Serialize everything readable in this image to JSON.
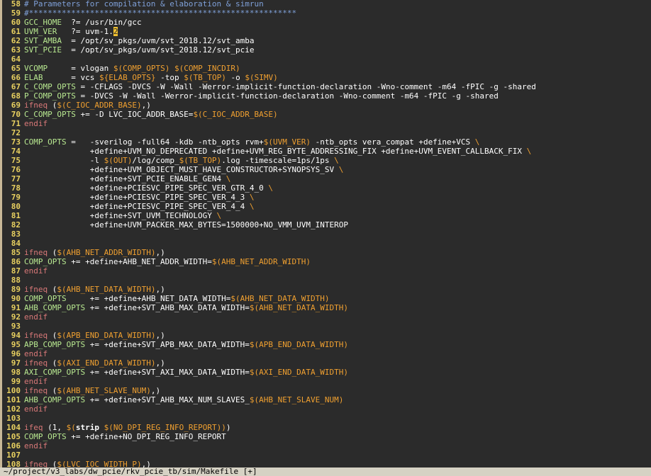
{
  "window": {
    "status_line": "~/project/v3_labs/dw_pcie/rkv_pcie_tb/sim/Makefile [+]"
  },
  "colors": {
    "background": "#2b2b2b",
    "line_number": "#e8d060",
    "comment": "#7fa0d8",
    "variable_ref": "#f0a030",
    "identifier": "#b8e890",
    "keyword": "#d87878",
    "text": "#ffffff",
    "cursor": "#f0c030",
    "status_bg": "#d6d2c4"
  },
  "lines": [
    {
      "n": "58",
      "t": [
        [
          "comment",
          "# Parameters for compilation & elaboration & simrun"
        ]
      ]
    },
    {
      "n": "59",
      "t": [
        [
          "comment",
          "#*********************************************************"
        ]
      ]
    },
    {
      "n": "60",
      "t": [
        [
          "ident",
          "GCC_HOME"
        ],
        [
          "normal",
          "  ?= /usr/bin/gcc"
        ]
      ]
    },
    {
      "n": "61",
      "t": [
        [
          "ident",
          "UVM_VER"
        ],
        [
          "normal",
          "   ?= uvm-1."
        ],
        [
          "cursor",
          "2"
        ]
      ]
    },
    {
      "n": "62",
      "t": [
        [
          "ident",
          "SVT_AMBA"
        ],
        [
          "normal",
          "  = /opt/sv_pkgs/uvm/svt_2018.12/svt_amba"
        ]
      ]
    },
    {
      "n": "63",
      "t": [
        [
          "ident",
          "SVT_PCIE"
        ],
        [
          "normal",
          "  = /opt/sv_pkgs/uvm/svt_2018.12/svt_pcie"
        ]
      ]
    },
    {
      "n": "64",
      "t": []
    },
    {
      "n": "65",
      "t": [
        [
          "ident",
          "VCOMP"
        ],
        [
          "normal",
          "     = vlogan "
        ],
        [
          "var",
          "$(COMP_OPTS)"
        ],
        [
          "normal",
          " "
        ],
        [
          "var",
          "$(COMP_INCDIR)"
        ]
      ]
    },
    {
      "n": "66",
      "t": [
        [
          "ident",
          "ELAB"
        ],
        [
          "normal",
          "      = vcs "
        ],
        [
          "var",
          "${ELAB_OPTS}"
        ],
        [
          "normal",
          " -top "
        ],
        [
          "var",
          "$(TB_TOP)"
        ],
        [
          "normal",
          " -o "
        ],
        [
          "var",
          "$(SIMV)"
        ]
      ]
    },
    {
      "n": "67",
      "t": [
        [
          "ident",
          "C_COMP_OPTS"
        ],
        [
          "normal",
          " = -CFLAGS -DVCS -W -Wall -Werror-implicit-function-declaration -Wno-comment -m64 -fPIC -g -shared"
        ]
      ]
    },
    {
      "n": "68",
      "t": [
        [
          "ident",
          "P_COMP_OPTS"
        ],
        [
          "normal",
          " = -DVCS -W -Wall -Werror-implicit-function-declaration -Wno-comment -m64 -fPIC -g -shared"
        ]
      ]
    },
    {
      "n": "69",
      "t": [
        [
          "keyword",
          "ifneq"
        ],
        [
          "normal",
          " ("
        ],
        [
          "var",
          "$(C_IOC_ADDR_BASE)"
        ],
        [
          "normal",
          ",)"
        ]
      ]
    },
    {
      "n": "70",
      "t": [
        [
          "ident",
          "C_COMP_OPTS"
        ],
        [
          "normal",
          " += -D LVC_IOC_ADDR_BASE="
        ],
        [
          "var",
          "$(C_IOC_ADDR_BASE)"
        ]
      ]
    },
    {
      "n": "71",
      "t": [
        [
          "keyword",
          "endif"
        ]
      ]
    },
    {
      "n": "72",
      "t": []
    },
    {
      "n": "73",
      "t": [
        [
          "ident",
          "COMP_OPTS"
        ],
        [
          "normal",
          " =   -sverilog -full64 -kdb -ntb_opts rvm+"
        ],
        [
          "var",
          "$(UVM_VER)"
        ],
        [
          "normal",
          " -ntb_opts vera_compat +define+VCS "
        ],
        [
          "var",
          "\\"
        ]
      ]
    },
    {
      "n": "74",
      "t": [
        [
          "normal",
          "              +define+UVM_NO_DEPRECATED +define+UVM_REG_BYTE_ADDRESSING_FIX +define+UVM_EVENT_CALLBACK_FIX "
        ],
        [
          "var",
          "\\"
        ]
      ]
    },
    {
      "n": "75",
      "t": [
        [
          "normal",
          "              -l "
        ],
        [
          "var",
          "$(OUT)"
        ],
        [
          "normal",
          "/log/comp_"
        ],
        [
          "var",
          "$(TB_TOP)"
        ],
        [
          "normal",
          ".log -timescale=1ps/1ps "
        ],
        [
          "var",
          "\\"
        ]
      ]
    },
    {
      "n": "76",
      "t": [
        [
          "normal",
          "              +define+UVM_OBJECT_MUST_HAVE_CONSTRUCTOR+SYNOPSYS_SV "
        ],
        [
          "var",
          "\\"
        ]
      ]
    },
    {
      "n": "77",
      "t": [
        [
          "normal",
          "              +define+SVT_PCIE_ENABLE_GEN4 "
        ],
        [
          "var",
          "\\"
        ]
      ]
    },
    {
      "n": "78",
      "t": [
        [
          "normal",
          "              +define+PCIESVC_PIPE_SPEC_VER_GTR_4_0 "
        ],
        [
          "var",
          "\\"
        ]
      ]
    },
    {
      "n": "79",
      "t": [
        [
          "normal",
          "              +define+PCIESVC_PIPE_SPEC_VER_4_3 "
        ],
        [
          "var",
          "\\"
        ]
      ]
    },
    {
      "n": "80",
      "t": [
        [
          "normal",
          "              +define+PCIESVC_PIPE_SPEC_VER_4_4 "
        ],
        [
          "var",
          "\\"
        ]
      ]
    },
    {
      "n": "81",
      "t": [
        [
          "normal",
          "              +define+SVT_UVM_TECHNOLOGY "
        ],
        [
          "var",
          "\\"
        ]
      ]
    },
    {
      "n": "82",
      "t": [
        [
          "normal",
          "              +define+UVM_PACKER_MAX_BYTES=1500000+NO_VMM_UVM_INTEROP"
        ]
      ]
    },
    {
      "n": "83",
      "t": []
    },
    {
      "n": "84",
      "t": []
    },
    {
      "n": "85",
      "t": [
        [
          "keyword",
          "ifneq"
        ],
        [
          "normal",
          " ("
        ],
        [
          "var",
          "$(AHB_NET_ADDR_WIDTH)"
        ],
        [
          "normal",
          ",)"
        ]
      ]
    },
    {
      "n": "86",
      "t": [
        [
          "ident",
          "COMP_OPTS"
        ],
        [
          "normal",
          " += +define+AHB_NET_ADDR_WIDTH="
        ],
        [
          "var",
          "$(AHB_NET_ADDR_WIDTH)"
        ]
      ]
    },
    {
      "n": "87",
      "t": [
        [
          "keyword",
          "endif"
        ]
      ]
    },
    {
      "n": "88",
      "t": []
    },
    {
      "n": "89",
      "t": [
        [
          "keyword",
          "ifneq"
        ],
        [
          "normal",
          " ("
        ],
        [
          "var",
          "$(AHB_NET_DATA_WIDTH)"
        ],
        [
          "normal",
          ",)"
        ]
      ]
    },
    {
      "n": "90",
      "t": [
        [
          "ident",
          "COMP_OPTS"
        ],
        [
          "normal",
          "     += +define+AHB_NET_DATA_WIDTH="
        ],
        [
          "var",
          "$(AHB_NET_DATA_WIDTH)"
        ]
      ]
    },
    {
      "n": "91",
      "t": [
        [
          "ident",
          "AHB_COMP_OPTS"
        ],
        [
          "normal",
          " += +define+SVT_AHB_MAX_DATA_WIDTH="
        ],
        [
          "var",
          "$(AHB_NET_DATA_WIDTH)"
        ]
      ]
    },
    {
      "n": "92",
      "t": [
        [
          "keyword",
          "endif"
        ]
      ]
    },
    {
      "n": "93",
      "t": []
    },
    {
      "n": "94",
      "t": [
        [
          "keyword",
          "ifneq"
        ],
        [
          "normal",
          " ("
        ],
        [
          "var",
          "$(APB_END_DATA_WIDTH)"
        ],
        [
          "normal",
          ",)"
        ]
      ]
    },
    {
      "n": "95",
      "t": [
        [
          "ident",
          "APB_COMP_OPTS"
        ],
        [
          "normal",
          " += +define+SVT_APB_MAX_DATA_WIDTH="
        ],
        [
          "var",
          "$(APB_END_DATA_WIDTH)"
        ]
      ]
    },
    {
      "n": "96",
      "t": [
        [
          "keyword",
          "endif"
        ]
      ]
    },
    {
      "n": "97",
      "t": [
        [
          "keyword",
          "ifneq"
        ],
        [
          "normal",
          " ("
        ],
        [
          "var",
          "$(AXI_END_DATA_WIDTH)"
        ],
        [
          "normal",
          ",)"
        ]
      ]
    },
    {
      "n": "98",
      "t": [
        [
          "ident",
          "AXI_COMP_OPTS"
        ],
        [
          "normal",
          " += +define+SVT_AXI_MAX_DATA_WIDTH="
        ],
        [
          "var",
          "$(AXI_END_DATA_WIDTH)"
        ]
      ]
    },
    {
      "n": "99",
      "t": [
        [
          "keyword",
          "endif"
        ]
      ]
    },
    {
      "n": "100",
      "t": [
        [
          "keyword",
          "ifneq"
        ],
        [
          "normal",
          " ("
        ],
        [
          "var",
          "$(AHB_NET_SLAVE_NUM)"
        ],
        [
          "normal",
          ",)"
        ]
      ]
    },
    {
      "n": "101",
      "t": [
        [
          "ident",
          "AHB_COMP_OPTS"
        ],
        [
          "normal",
          " += +define+SVT_AHB_MAX_NUM_SLAVES_"
        ],
        [
          "var",
          "$(AHB_NET_SLAVE_NUM)"
        ]
      ]
    },
    {
      "n": "102",
      "t": [
        [
          "keyword",
          "endif"
        ]
      ]
    },
    {
      "n": "103",
      "t": []
    },
    {
      "n": "104",
      "t": [
        [
          "keyword",
          "ifeq"
        ],
        [
          "normal",
          " (1, "
        ],
        [
          "var",
          "$("
        ],
        [
          "bold",
          "strip"
        ],
        [
          "normal",
          " "
        ],
        [
          "var",
          "$(NO_DPI_REG_INFO_REPORT)"
        ],
        [
          "var",
          ")"
        ],
        [
          "normal",
          ")"
        ]
      ]
    },
    {
      "n": "105",
      "t": [
        [
          "ident",
          "COMP_OPTS"
        ],
        [
          "normal",
          " += +define+NO_DPI_REG_INFO_REPORT"
        ]
      ]
    },
    {
      "n": "106",
      "t": [
        [
          "keyword",
          "endif"
        ]
      ]
    },
    {
      "n": "107",
      "t": []
    },
    {
      "n": "108",
      "t": [
        [
          "keyword",
          "ifneq"
        ],
        [
          "normal",
          " ("
        ],
        [
          "var",
          "$(LVC_IOC_WIDTH_P)"
        ],
        [
          "normal",
          ",)"
        ]
      ]
    }
  ]
}
